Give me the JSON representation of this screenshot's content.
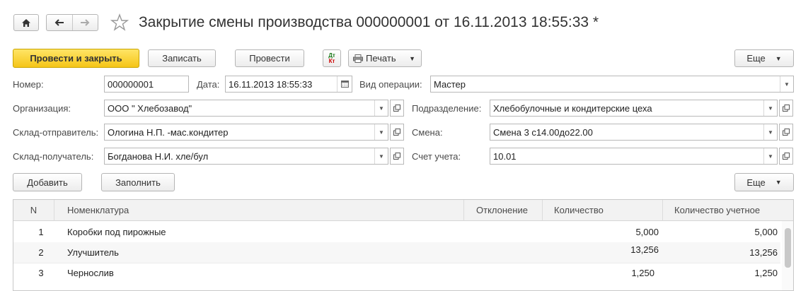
{
  "window": {
    "title": "Закрытие смены производства 000000001 от 16.11.2013 18:55:33 *"
  },
  "toolbar": {
    "post_and_close": "Провести и закрыть",
    "save": "Записать",
    "post": "Провести",
    "dt_kt_top": "Дт",
    "dt_kt_bottom": "Кт",
    "print": "Печать",
    "more": "Еще"
  },
  "form": {
    "number_label": "Номер:",
    "number_value": "000000001",
    "date_label": "Дата:",
    "date_value": "16.11.2013 18:55:33",
    "operation_label": "Вид операции:",
    "operation_value": "Мастер",
    "org_label": "Организация:",
    "org_value": "ООО \" Хлебозавод\"",
    "division_label": "Подразделение:",
    "division_value": "Хлебобулочные и кондитерские цеха",
    "sender_label": "Склад-отправитель:",
    "sender_value": "Ологина Н.П. -мас.кондитер",
    "shift_label": "Смена:",
    "shift_value": "Смена 3 с14.00до22.00",
    "receiver_label": "Склад-получатель:",
    "receiver_value": "Богданова Н.И. хле/бул",
    "account_label": "Счет учета:",
    "account_value": "10.01"
  },
  "table_toolbar": {
    "add": "Добавить",
    "fill": "Заполнить",
    "more": "Еще"
  },
  "table": {
    "columns": [
      "N",
      "Номенклатура",
      "Отклонение",
      "Количество",
      "Количество учетное"
    ],
    "rows": [
      {
        "n": "1",
        "item": "Коробки под пирожные",
        "deviation": "",
        "qty": "5,000",
        "qty_acc": "5,000"
      },
      {
        "n": "2",
        "item": "Улучшитель",
        "deviation": "",
        "qty": "13,256",
        "qty_acc": "13,256"
      },
      {
        "n": "3",
        "item": "Чернослив",
        "deviation": "",
        "qty": "1,250",
        "qty_acc": "1,250"
      }
    ]
  }
}
